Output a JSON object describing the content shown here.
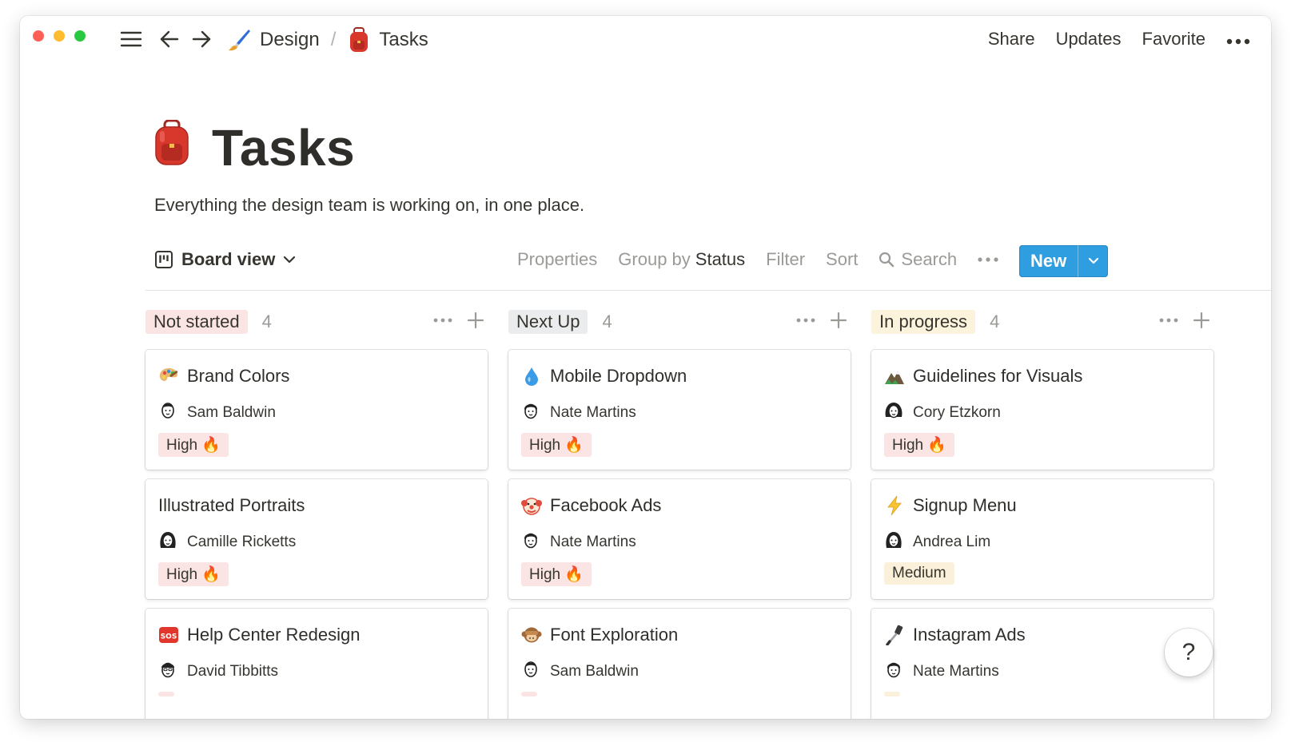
{
  "topbar": {
    "breadcrumbs": [
      {
        "label": "Design",
        "icon": "paintbrush-icon"
      },
      {
        "label": "Tasks",
        "icon": "backpack-icon"
      }
    ],
    "separator": "/",
    "actions": [
      "Share",
      "Updates",
      "Favorite"
    ]
  },
  "page": {
    "title": "Tasks",
    "icon": "backpack-icon",
    "description": "Everything the design team is working on, in one place."
  },
  "toolbar": {
    "view": "Board view",
    "properties": "Properties",
    "group_by_prefix": "Group by",
    "group_by_value": "Status",
    "filter": "Filter",
    "sort": "Sort",
    "search": "Search",
    "new": "New"
  },
  "columns": [
    {
      "status": "Not started",
      "count": "4",
      "color": "#fbe4e4",
      "cards": [
        {
          "title": "Brand Colors",
          "icon": "palette-icon",
          "assignee": "Sam Baldwin",
          "priority": "High 🔥",
          "level": "high"
        },
        {
          "title": "Illustrated Portraits",
          "icon": "",
          "assignee": "Camille Ricketts",
          "priority": "High 🔥",
          "level": "high"
        },
        {
          "title": "Help Center Redesign",
          "icon": "sos-icon",
          "assignee": "David Tibbitts",
          "priority": "",
          "level": "high"
        }
      ]
    },
    {
      "status": "Next Up",
      "count": "4",
      "color": "#ebeced",
      "cards": [
        {
          "title": "Mobile Dropdown",
          "icon": "droplet-icon",
          "assignee": "Nate Martins",
          "priority": "High 🔥",
          "level": "high"
        },
        {
          "title": "Facebook Ads",
          "icon": "clown-icon",
          "assignee": "Nate Martins",
          "priority": "High 🔥",
          "level": "high"
        },
        {
          "title": "Font Exploration",
          "icon": "monkey-icon",
          "assignee": "Sam Baldwin",
          "priority": "",
          "level": "high"
        }
      ]
    },
    {
      "status": "In progress",
      "count": "4",
      "color": "#fbf3db",
      "cards": [
        {
          "title": "Guidelines for Visuals",
          "icon": "mountain-icon",
          "assignee": "Cory Etzkorn",
          "priority": "High 🔥",
          "level": "high"
        },
        {
          "title": "Signup Menu",
          "icon": "lightning-icon",
          "assignee": "Andrea Lim",
          "priority": "Medium",
          "level": "med"
        },
        {
          "title": "Instagram Ads",
          "icon": "selfie-stick-icon",
          "assignee": "Nate Martins",
          "priority": "",
          "level": "med"
        }
      ]
    }
  ],
  "help": "?"
}
